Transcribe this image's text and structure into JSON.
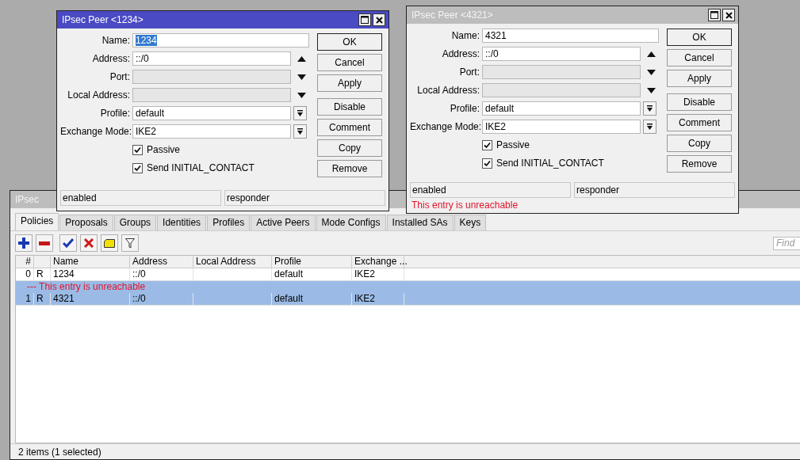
{
  "main_window": {
    "title": "IPsec",
    "tabs": [
      {
        "label": "Policies",
        "selected": true
      },
      {
        "label": "Proposals",
        "selected": false
      },
      {
        "label": "Groups",
        "selected": false
      },
      {
        "label": "Identities",
        "selected": false
      },
      {
        "label": "Profiles",
        "selected": false
      },
      {
        "label": "Active Peers",
        "selected": false
      },
      {
        "label": "Mode Configs",
        "selected": false
      },
      {
        "label": "Installed SAs",
        "selected": false
      },
      {
        "label": "Keys",
        "selected": false
      }
    ],
    "toolbar": [
      {
        "kind": "add"
      },
      {
        "kind": "remove"
      },
      {
        "kind": "enable"
      },
      {
        "kind": "disable"
      },
      {
        "kind": "comment"
      },
      {
        "kind": "filter"
      }
    ],
    "search": {
      "placeholder": "Find"
    },
    "table": {
      "columns": [
        "#",
        "Name",
        "Address",
        "Local Address",
        "Profile",
        "Exchange ..."
      ],
      "rows": [
        {
          "number": "0",
          "flag": "R",
          "name": "1234",
          "address": "::/0",
          "profile": "default",
          "exchange_mode": "IKE2",
          "selected": false
        },
        {
          "comment": "--- This entry is unreachable",
          "number": "1",
          "flag": "R",
          "name": "4321",
          "address": "::/0",
          "profile": "default",
          "exchange_mode": "IKE2",
          "selected": true
        }
      ]
    },
    "status_bar": "2 items (1 selected)"
  },
  "dialogs": [
    {
      "title": "IPsec Peer <1234>",
      "active": true,
      "fields": [
        {
          "label": "Name:",
          "value": "1234",
          "kind": "text",
          "disabled": false,
          "highlighted": true
        },
        {
          "label": "Address:",
          "value": "::/0",
          "kind": "up",
          "disabled": false
        },
        {
          "label": "Port:",
          "kind": "down",
          "disabled": true
        },
        {
          "label": "Local Address:",
          "kind": "down",
          "disabled": true
        },
        {
          "label": "Profile:",
          "value": "default",
          "kind": "select",
          "disabled": false
        },
        {
          "label": "Exchange Mode:",
          "value": "IKE2",
          "kind": "select",
          "disabled": false
        }
      ],
      "checkboxes": [
        {
          "label": "Passive",
          "checked": true
        },
        {
          "label": "Send INITIAL_CONTACT",
          "checked": true
        }
      ],
      "buttons": [
        "OK",
        "Cancel",
        "Apply",
        "Disable",
        "Comment",
        "Copy",
        "Remove"
      ],
      "status": [
        "enabled",
        "responder"
      ]
    },
    {
      "title": "IPsec Peer <4321>",
      "active": false,
      "fields": [
        {
          "label": "Name:",
          "value": "4321",
          "kind": "text",
          "disabled": false,
          "highlighted": false
        },
        {
          "label": "Address:",
          "value": "::/0",
          "kind": "up",
          "disabled": false
        },
        {
          "label": "Port:",
          "kind": "down",
          "disabled": true
        },
        {
          "label": "Local Address:",
          "kind": "down",
          "disabled": true
        },
        {
          "label": "Profile:",
          "value": "default",
          "kind": "select",
          "disabled": false
        },
        {
          "label": "Exchange Mode:",
          "value": "IKE2",
          "kind": "select",
          "disabled": false
        }
      ],
      "checkboxes": [
        {
          "label": "Passive",
          "checked": true
        },
        {
          "label": "Send INITIAL_CONTACT",
          "checked": true
        }
      ],
      "buttons": [
        "OK",
        "Cancel",
        "Apply",
        "Disable",
        "Comment",
        "Copy",
        "Remove"
      ],
      "status": [
        "enabled",
        "responder"
      ],
      "message": "This entry is unreachable"
    }
  ]
}
